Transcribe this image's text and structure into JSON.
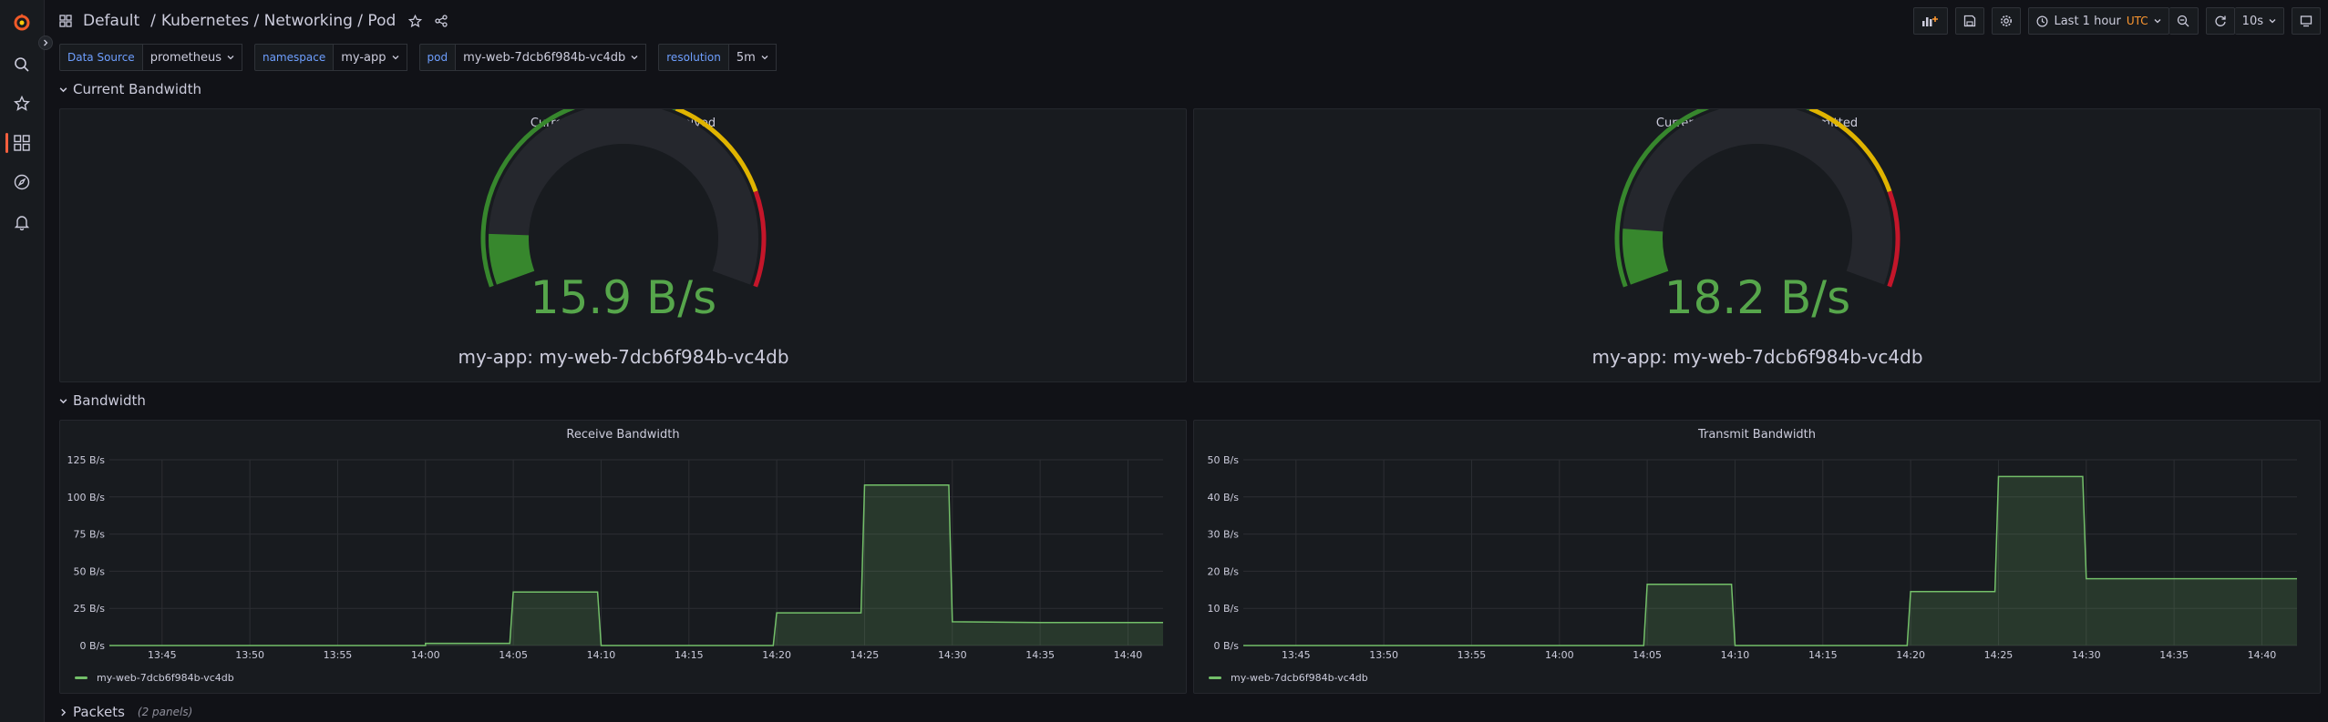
{
  "breadcrumb": {
    "folder": "Default",
    "separator": "/",
    "title": "Kubernetes / Networking / Pod"
  },
  "toolbar": {
    "time_range": "Last 1 hour",
    "timezone": "UTC",
    "refresh": "10s"
  },
  "variables": [
    {
      "label": "Data Source",
      "value": "prometheus"
    },
    {
      "label": "namespace",
      "value": "my-app"
    },
    {
      "label": "pod",
      "value": "my-web-7dcb6f984b-vc4db"
    },
    {
      "label": "resolution",
      "value": "5m"
    }
  ],
  "rows": {
    "current_bandwidth": "Current Bandwidth",
    "bandwidth": "Bandwidth",
    "packets": "Packets",
    "packets_note": "(2 panels)"
  },
  "gauges": [
    {
      "title": "Current Rate of Bytes Received",
      "value_text": "15.9 B/s",
      "fraction": 0.1,
      "series_label": "my-app: my-web-7dcb6f984b-vc4db"
    },
    {
      "title": "Current Rate of Bytes Transmitted",
      "value_text": "18.2 B/s",
      "fraction": 0.11,
      "series_label": "my-app: my-web-7dcb6f984b-vc4db"
    }
  ],
  "colors": {
    "accent": "#f55f3e",
    "series_green": "#73bf69",
    "gauge_green": "#37872d",
    "gauge_value": "#56a64b",
    "gauge_yellow": "#e0b400",
    "gauge_red": "#c4162a",
    "variable_label": "#6e9fff",
    "utc": "#ff9830"
  },
  "chart_data": [
    {
      "type": "area",
      "title": "Receive Bandwidth",
      "xlabel": "",
      "ylabel": "",
      "x_ticks": [
        "13:45",
        "13:50",
        "13:55",
        "14:00",
        "14:05",
        "14:10",
        "14:15",
        "14:20",
        "14:25",
        "14:30",
        "14:35",
        "14:40"
      ],
      "y_ticks": [
        "0 B/s",
        "25 B/s",
        "50 B/s",
        "75 B/s",
        "100 B/s",
        "125 B/s"
      ],
      "ylim": [
        0,
        125
      ],
      "xlim": [
        "13:42",
        "14:42"
      ],
      "grid": true,
      "legend_position": "bottom-left",
      "series": [
        {
          "name": "my-web-7dcb6f984b-vc4db",
          "x": [
            "13:42",
            "14:00",
            "14:00",
            "14:04.8",
            "14:05",
            "14:09.8",
            "14:10",
            "14:19.8",
            "14:20",
            "14:24.8",
            "14:25",
            "14:29.8",
            "14:30",
            "14:35",
            "14:42"
          ],
          "values": [
            0,
            0,
            1.5,
            1.5,
            36,
            36,
            0,
            0,
            22,
            22,
            108,
            108,
            16,
            15.5,
            15.5
          ]
        }
      ]
    },
    {
      "type": "area",
      "title": "Transmit Bandwidth",
      "xlabel": "",
      "ylabel": "",
      "x_ticks": [
        "13:45",
        "13:50",
        "13:55",
        "14:00",
        "14:05",
        "14:10",
        "14:15",
        "14:20",
        "14:25",
        "14:30",
        "14:35",
        "14:40"
      ],
      "y_ticks": [
        "0 B/s",
        "10 B/s",
        "20 B/s",
        "30 B/s",
        "40 B/s",
        "50 B/s"
      ],
      "ylim": [
        0,
        50
      ],
      "xlim": [
        "13:42",
        "14:42"
      ],
      "grid": true,
      "legend_position": "bottom-left",
      "series": [
        {
          "name": "my-web-7dcb6f984b-vc4db",
          "x": [
            "13:42",
            "14:04.8",
            "14:05",
            "14:09.8",
            "14:10",
            "14:19.8",
            "14:20",
            "14:24.8",
            "14:25",
            "14:29.8",
            "14:30",
            "14:42"
          ],
          "values": [
            0,
            0,
            16.5,
            16.5,
            0,
            0,
            14.5,
            14.5,
            45.5,
            45.5,
            18,
            18
          ]
        }
      ]
    }
  ]
}
